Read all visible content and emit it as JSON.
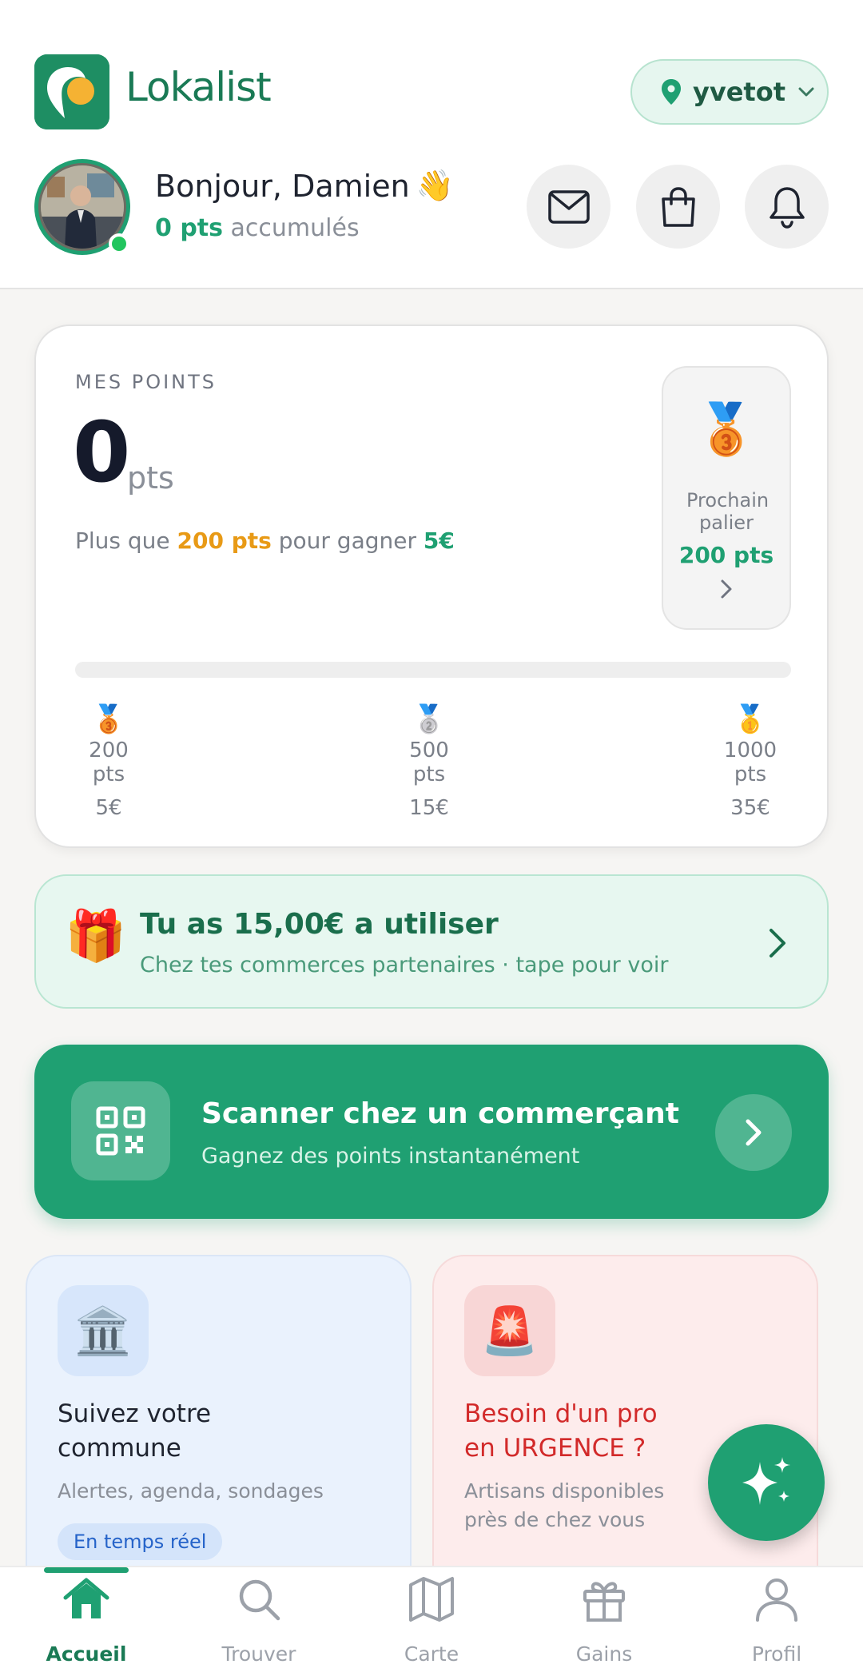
{
  "app": {
    "name": "Lokalist"
  },
  "location": {
    "city": "yvetot"
  },
  "user": {
    "greeting": "Bonjour, Damien",
    "wave_emoji": "👋",
    "points_value": "0 pts",
    "points_suffix": " accumulés"
  },
  "header_actions": [
    {
      "name": "messages",
      "icon": "envelope-icon"
    },
    {
      "name": "shop",
      "icon": "shopping-bag-icon"
    },
    {
      "name": "notifications",
      "icon": "bell-icon"
    }
  ],
  "points_card": {
    "label": "MES POINTS",
    "points": "0",
    "unit": "pts",
    "hint_prefix": "Plus que ",
    "hint_points": "200 pts",
    "hint_middle": " pour gagner ",
    "hint_reward": "5€",
    "progress_fraction": 0,
    "next_tier": {
      "label": "Prochain palier",
      "points": "200 pts",
      "medal": "🥉"
    },
    "tiers": [
      {
        "medal": "🥉",
        "points": "200 pts",
        "reward": "5€"
      },
      {
        "medal": "🥈",
        "points": "500 pts",
        "reward": "15€"
      },
      {
        "medal": "🥇",
        "points": "1000 pts",
        "reward": "35€"
      }
    ]
  },
  "wallet_card": {
    "emoji": "🎁",
    "title": "Tu as 15,00€ a utiliser",
    "subtitle": "Chez tes commerces partenaires · tape pour voir"
  },
  "scan_card": {
    "title": "Scanner chez un commerçant",
    "subtitle": "Gagnez des points instantanément"
  },
  "tiles": {
    "commune": {
      "emoji": "🏛️",
      "title_line1": "Suivez votre",
      "title_line2": "commune",
      "subtitle": "Alertes, agenda, sondages",
      "badge": "En temps réel"
    },
    "urgence": {
      "emoji": "🚨",
      "title_line1": "Besoin d'un pro",
      "title_line2": "en URGENCE ?",
      "subtitle_line1": "Artisans disponibles",
      "subtitle_line2": "près de chez vous"
    }
  },
  "nav": {
    "items": [
      {
        "label": "Accueil",
        "icon": "home-icon",
        "active": true
      },
      {
        "label": "Trouver",
        "icon": "search-icon",
        "active": false
      },
      {
        "label": "Carte",
        "icon": "map-icon",
        "active": false
      },
      {
        "label": "Gains",
        "icon": "gift-icon",
        "active": false
      },
      {
        "label": "Profil",
        "icon": "profile-icon",
        "active": false
      }
    ]
  },
  "colors": {
    "brand_green": "#1fa072",
    "brand_dark_green": "#1a7a55",
    "accent_orange": "#e89a16",
    "urgent_red": "#d22a2a"
  }
}
